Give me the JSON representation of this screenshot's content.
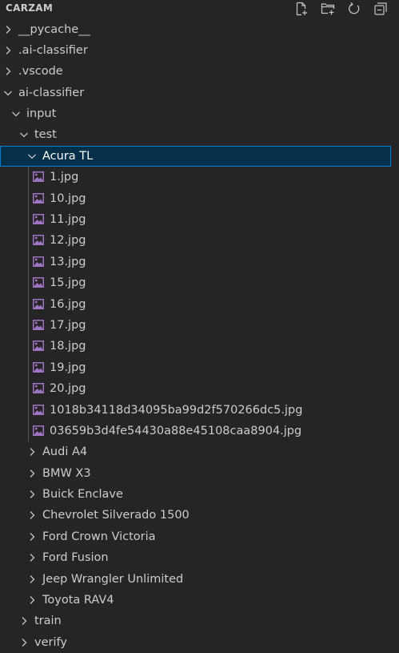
{
  "explorer": {
    "title": "CARZAM",
    "actions": [
      {
        "icon": "new-file-icon"
      },
      {
        "icon": "new-folder-icon"
      },
      {
        "icon": "refresh-icon"
      },
      {
        "icon": "collapse-all-icon"
      }
    ]
  },
  "tree": [
    {
      "label": "__pycache__",
      "type": "folder",
      "expanded": false,
      "depth": 0
    },
    {
      "label": ".ai-classifier",
      "type": "folder",
      "expanded": false,
      "depth": 0
    },
    {
      "label": ".vscode",
      "type": "folder",
      "expanded": false,
      "depth": 0
    },
    {
      "label": "ai-classifier",
      "type": "folder",
      "expanded": true,
      "depth": 0
    },
    {
      "label": "input",
      "type": "folder",
      "expanded": true,
      "depth": 1
    },
    {
      "label": "test",
      "type": "folder",
      "expanded": true,
      "depth": 2
    },
    {
      "label": "Acura TL",
      "type": "folder",
      "expanded": true,
      "depth": 3,
      "selected": true
    },
    {
      "label": "1.jpg",
      "type": "image",
      "depth": 4
    },
    {
      "label": "10.jpg",
      "type": "image",
      "depth": 4
    },
    {
      "label": "11.jpg",
      "type": "image",
      "depth": 4
    },
    {
      "label": "12.jpg",
      "type": "image",
      "depth": 4
    },
    {
      "label": "13.jpg",
      "type": "image",
      "depth": 4
    },
    {
      "label": "15.jpg",
      "type": "image",
      "depth": 4
    },
    {
      "label": "16.jpg",
      "type": "image",
      "depth": 4
    },
    {
      "label": "17.jpg",
      "type": "image",
      "depth": 4
    },
    {
      "label": "18.jpg",
      "type": "image",
      "depth": 4
    },
    {
      "label": "19.jpg",
      "type": "image",
      "depth": 4
    },
    {
      "label": "20.jpg",
      "type": "image",
      "depth": 4
    },
    {
      "label": "1018b34118d34095ba99d2f570266dc5.jpg",
      "type": "image",
      "depth": 4
    },
    {
      "label": "03659b3d4fe54430a88e45108caa8904.jpg",
      "type": "image",
      "depth": 4
    },
    {
      "label": "Audi A4",
      "type": "folder",
      "expanded": false,
      "depth": 3
    },
    {
      "label": "BMW X3",
      "type": "folder",
      "expanded": false,
      "depth": 3
    },
    {
      "label": "Buick Enclave",
      "type": "folder",
      "expanded": false,
      "depth": 3
    },
    {
      "label": "Chevrolet Silverado 1500",
      "type": "folder",
      "expanded": false,
      "depth": 3
    },
    {
      "label": "Ford Crown Victoria",
      "type": "folder",
      "expanded": false,
      "depth": 3
    },
    {
      "label": "Ford Fusion",
      "type": "folder",
      "expanded": false,
      "depth": 3
    },
    {
      "label": "Jeep Wrangler Unlimited",
      "type": "folder",
      "expanded": false,
      "depth": 3
    },
    {
      "label": "Toyota RAV4",
      "type": "folder",
      "expanded": false,
      "depth": 3
    },
    {
      "label": "train",
      "type": "folder",
      "expanded": false,
      "depth": 2
    },
    {
      "label": "verify",
      "type": "folder",
      "expanded": false,
      "depth": 2
    }
  ],
  "colors": {
    "background": "#252526",
    "text": "#cccccc",
    "selection_background": "#062f4a",
    "selection_border": "#007fd4",
    "image_icon": "#a074c4",
    "indent_guide": "#585858"
  }
}
